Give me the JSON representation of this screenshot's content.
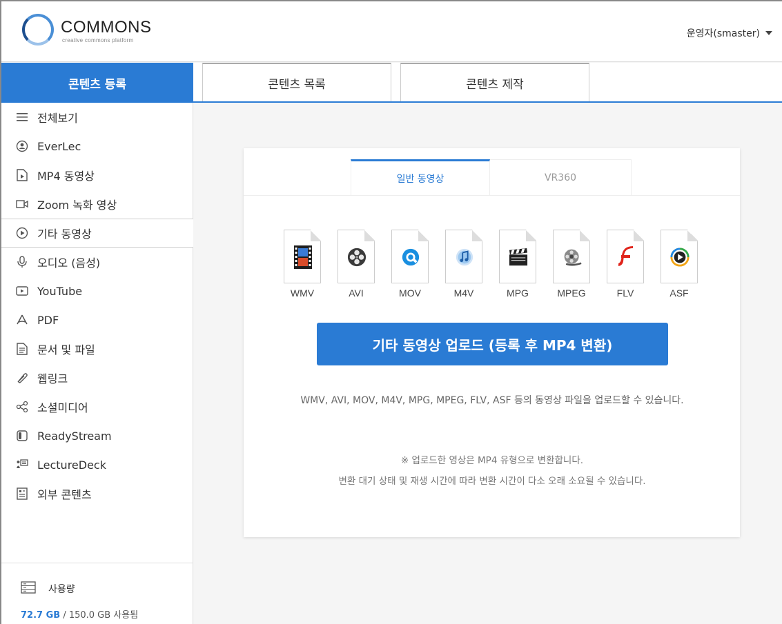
{
  "header": {
    "logo_text": "COMMONS",
    "logo_subtext": "creative commons platform",
    "user_label": "운영자(smaster)"
  },
  "top_tabs": {
    "register": "콘텐츠 등록",
    "list": "콘텐츠 목록",
    "make": "콘텐츠 제작"
  },
  "sidebar": {
    "items": [
      {
        "label": "전체보기",
        "icon": "menu-icon"
      },
      {
        "label": "EverLec",
        "icon": "everlec-icon"
      },
      {
        "label": "MP4 동영상",
        "icon": "video-file-icon"
      },
      {
        "label": "Zoom 녹화 영상",
        "icon": "zoom-camera-icon"
      },
      {
        "label": "기타 동영상",
        "icon": "play-circle-icon"
      },
      {
        "label": "오디오 (음성)",
        "icon": "microphone-icon"
      },
      {
        "label": "YouTube",
        "icon": "youtube-icon"
      },
      {
        "label": "PDF",
        "icon": "pdf-icon"
      },
      {
        "label": "문서 및 파일",
        "icon": "document-icon"
      },
      {
        "label": "웹링크",
        "icon": "link-icon"
      },
      {
        "label": "소셜미디어",
        "icon": "share-icon"
      },
      {
        "label": "ReadyStream",
        "icon": "readystream-icon"
      },
      {
        "label": "LectureDeck",
        "icon": "lecturedeck-icon"
      },
      {
        "label": "외부 콘텐츠",
        "icon": "external-content-icon"
      }
    ],
    "active_index": 4,
    "usage": {
      "label": "사용량",
      "used": "72.7 GB",
      "rest": " / 150.0 GB 사용됨"
    }
  },
  "card": {
    "sub_tabs": {
      "general": "일반 동영상",
      "vr": "VR360"
    },
    "formats": [
      {
        "label": "WMV",
        "icon": "wmv-film-icon"
      },
      {
        "label": "AVI",
        "icon": "avi-reel-icon"
      },
      {
        "label": "MOV",
        "icon": "quicktime-icon"
      },
      {
        "label": "M4V",
        "icon": "itunes-icon"
      },
      {
        "label": "MPG",
        "icon": "clapperboard-icon"
      },
      {
        "label": "MPEG",
        "icon": "film-reel-icon"
      },
      {
        "label": "FLV",
        "icon": "flash-icon"
      },
      {
        "label": "ASF",
        "icon": "media-player-icon"
      }
    ],
    "upload_button": "기타 동영상 업로드 (등록 후 MP4 변환)",
    "description": "WMV, AVI, MOV, M4V, MPG, MPEG, FLV, ASF 등의 동영상 파일을 업로드할 수 있습니다.",
    "note_line1": "※ 업로드한 영상은 MP4 유형으로 변환합니다.",
    "note_line2": "변환 대기 상태 및 재생 시간에 따라 변환 시간이 다소 오래 소요될 수 있습니다."
  },
  "colors": {
    "accent": "#2a7bd4"
  }
}
